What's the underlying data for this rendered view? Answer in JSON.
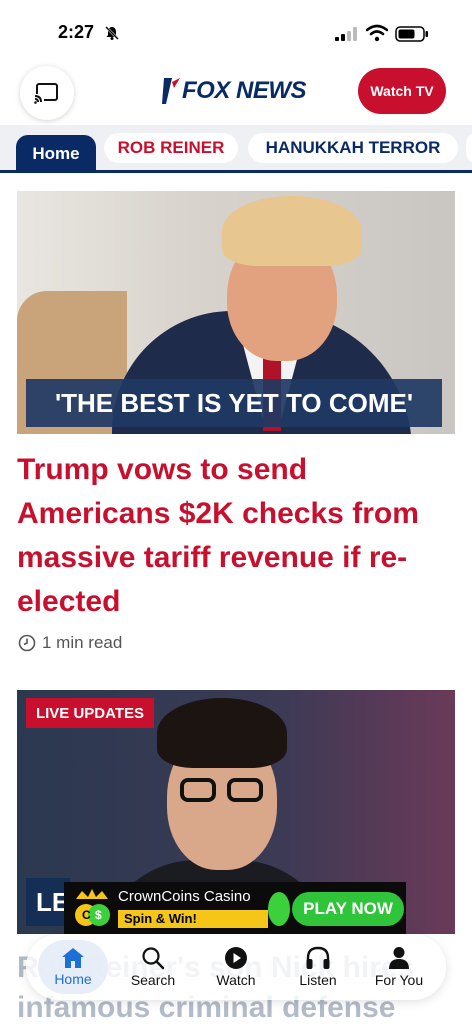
{
  "status_bar": {
    "time": "2:27"
  },
  "header": {
    "logo_text": "FOX NEWS",
    "watch_button": "Watch TV"
  },
  "tabs": [
    {
      "label": "Home"
    },
    {
      "label": "ROB REINER"
    },
    {
      "label": "HANUKKAH TERROR"
    }
  ],
  "lead_story": {
    "banner": "'THE BEST IS YET TO COME'",
    "headline": "Trump vows to send Americans $2K checks from massive tariff revenue if re-elected",
    "read_time": "1 min read"
  },
  "second_story": {
    "badge": "LIVE UPDATES",
    "banner_partial": "LE",
    "headline_partial": "Rob Reiner's son Nick hires infamous criminal defense"
  },
  "ad": {
    "title": "CrownCoins Casino",
    "subtitle": "Spin & Win!",
    "cta": "PLAY NOW"
  },
  "bottom_nav": [
    {
      "label": "Home",
      "icon": "home-icon"
    },
    {
      "label": "Search",
      "icon": "search-icon"
    },
    {
      "label": "Watch",
      "icon": "play-icon"
    },
    {
      "label": "Listen",
      "icon": "headphones-icon"
    },
    {
      "label": "For You",
      "icon": "person-icon"
    }
  ],
  "colors": {
    "brand_red": "#c8102e",
    "brand_navy": "#0a2a66",
    "active_nav": "#1d6fd8"
  }
}
